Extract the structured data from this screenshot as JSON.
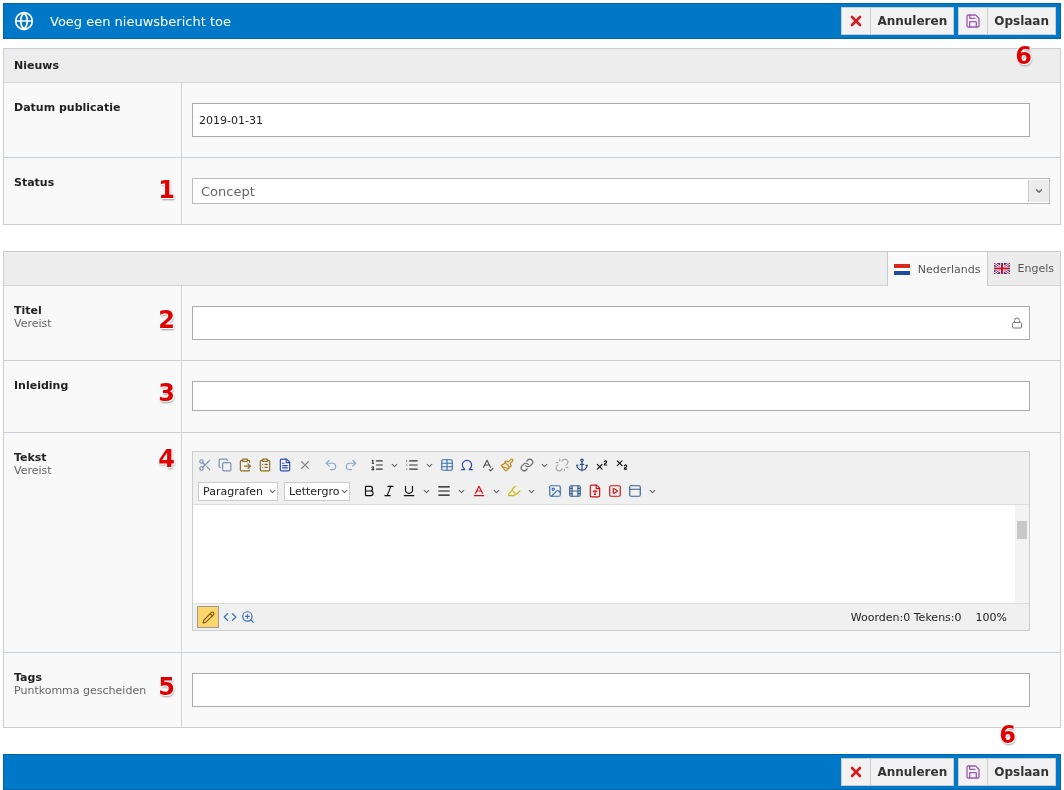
{
  "header": {
    "title": "Voeg een nieuwsbericht toe",
    "marker": "6",
    "buttons": [
      {
        "kind": "cancel",
        "label": "Annuleren"
      },
      {
        "kind": "save",
        "label": "Opslaan"
      }
    ]
  },
  "news_panel": {
    "title": "Nieuws",
    "rows": [
      {
        "label": "Datum publicatie",
        "kind": "text",
        "value": "2019-01-31"
      },
      {
        "label": "Status",
        "kind": "select",
        "value": "Concept",
        "marker": "1"
      }
    ]
  },
  "content_panel": {
    "tabs": [
      {
        "label": "Nederlands",
        "kind": "nl",
        "selected": true
      },
      {
        "label": "Engels",
        "kind": "gb",
        "selected": false
      }
    ],
    "rows": [
      {
        "label": "Titel",
        "hint": "Vereist",
        "kind": "text",
        "marker": "2"
      },
      {
        "label": "Inleiding",
        "kind": "textarea",
        "marker": "3"
      },
      {
        "label": "Tekst",
        "hint": "Vereist",
        "kind": "editor",
        "marker": "4",
        "editor": {
          "format": "Paragrafen",
          "font_size": "Lettergro",
          "word_count": "Woorden:0 Tekens:0",
          "zoom": "100%"
        }
      },
      {
        "label": "Tags",
        "hint": "Puntkomma gescheiden",
        "kind": "text",
        "marker": "5"
      }
    ]
  },
  "footer": {
    "marker": "6",
    "buttons": [
      {
        "kind": "cancel",
        "label": "Annuleren"
      },
      {
        "kind": "save",
        "label": "Opslaan"
      }
    ]
  }
}
